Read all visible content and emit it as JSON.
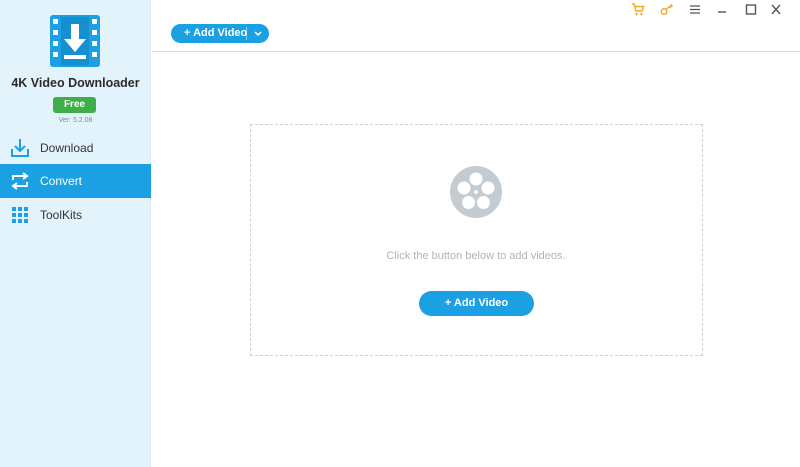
{
  "app": {
    "title": "4K Video Downloader",
    "badge": "Free",
    "version": "Ver: 5.2.08"
  },
  "sidebar": {
    "items": [
      {
        "label": "Download",
        "icon": "download-icon",
        "active": false
      },
      {
        "label": "Convert",
        "icon": "convert-icon",
        "active": true
      },
      {
        "label": "ToolKits",
        "icon": "grid-icon",
        "active": false
      }
    ]
  },
  "toolbar": {
    "add_video_label": "+ Add Video"
  },
  "window_controls": [
    "cart-icon",
    "key-icon",
    "menu-icon",
    "minimize-icon",
    "maximize-icon",
    "close-icon"
  ],
  "dropzone": {
    "hint": "Click the button below to add videos.",
    "add_video_label": "+ Add Video"
  },
  "colors": {
    "accent": "#1aa0e3",
    "sidebar_bg": "#e3f3fc",
    "badge_green": "#3fae49",
    "control_orange": "#f5a623"
  }
}
